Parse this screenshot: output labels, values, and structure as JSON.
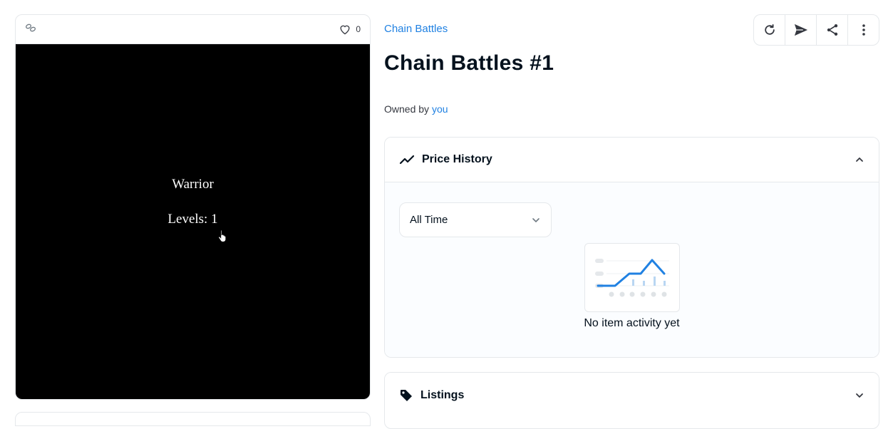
{
  "media": {
    "favorite_count": "0",
    "nft_name": "Warrior",
    "nft_level": "Levels: 1"
  },
  "item": {
    "collection": "Chain Battles",
    "title": "Chain Battles #1",
    "owned_by_label": "Owned by",
    "owner": "you"
  },
  "toolbar": {
    "icons": [
      "refresh-icon",
      "transfer-icon",
      "share-icon",
      "more-icon"
    ]
  },
  "price_history": {
    "title": "Price History",
    "time_filter": "All Time",
    "empty_message": "No item activity yet"
  },
  "listings": {
    "title": "Listings"
  },
  "colors": {
    "link": "#2081e2",
    "border": "#e5e8eb",
    "chart_line": "#2081e2"
  }
}
